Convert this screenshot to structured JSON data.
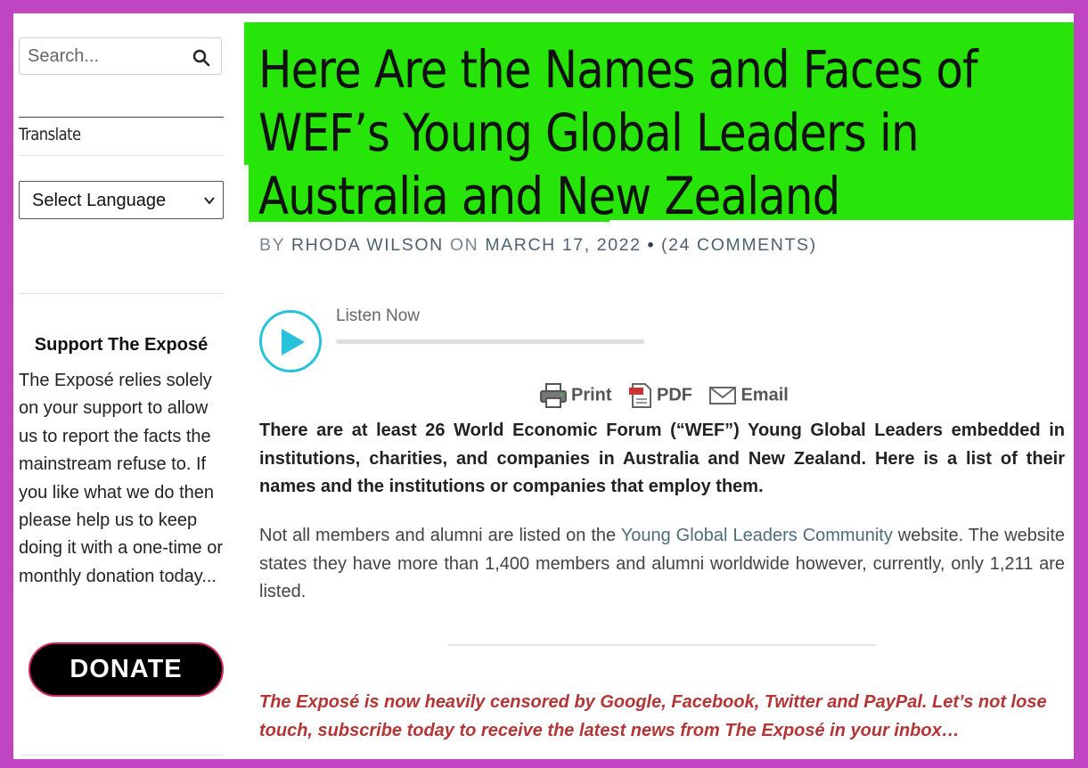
{
  "sidebar": {
    "search": {
      "placeholder": "Search..."
    },
    "translate": {
      "label": "Translate",
      "selected_language": "Select Language"
    },
    "support": {
      "title": "Support The Exposé",
      "text": "The Exposé relies solely on your support to allow us to report the facts the mainstream refuse to. If you like what we do then please help us to keep doing it with a one-time or monthly donation today...",
      "donate_label": "DONATE"
    }
  },
  "article": {
    "title": "Here Are the Names and Faces of WEF’s Young Global Leaders in Australia and New Zealand",
    "meta": {
      "by": "BY",
      "author": "RHODA WILSON",
      "on": "ON",
      "date": "MARCH 17, 2022",
      "bullet": "•",
      "comments_open": "(",
      "comments": "24 COMMENTS",
      "comments_close": ")"
    },
    "player": {
      "label": "Listen Now",
      "progress": 0
    },
    "print_bar": {
      "print": "Print",
      "pdf": "PDF",
      "email": "Email"
    },
    "lead": "There are at least 26 World Economic Forum (“WEF”) Young Global Leaders embedded in institutions, charities, and companies in Australia and New Zealand.  Here is a list of their names and the institutions or companies that employ them.",
    "body": {
      "before_link": "Not all members and alumni are listed on the ",
      "link": "Young Global Leaders Community",
      "after_link": " website.  The website states they have more than 1,400 members and alumni worldwide however, currently, only 1,211 are listed."
    },
    "notice": "The Exposé is now heavily censored by Google, Facebook, Twitter and PayPal. Let’s not lose touch, subscribe today to receive the latest news from The Exposé in your inbox…"
  },
  "colors": {
    "frame": "#bf45c2",
    "title_bg": "#27e409",
    "player_accent": "#27c3dd",
    "notice_text": "#b33535",
    "donate_border": "#d4265e"
  },
  "icons": [
    "search-icon",
    "chevron-down-icon",
    "play-icon",
    "printer-icon",
    "pdf-icon",
    "email-icon"
  ]
}
